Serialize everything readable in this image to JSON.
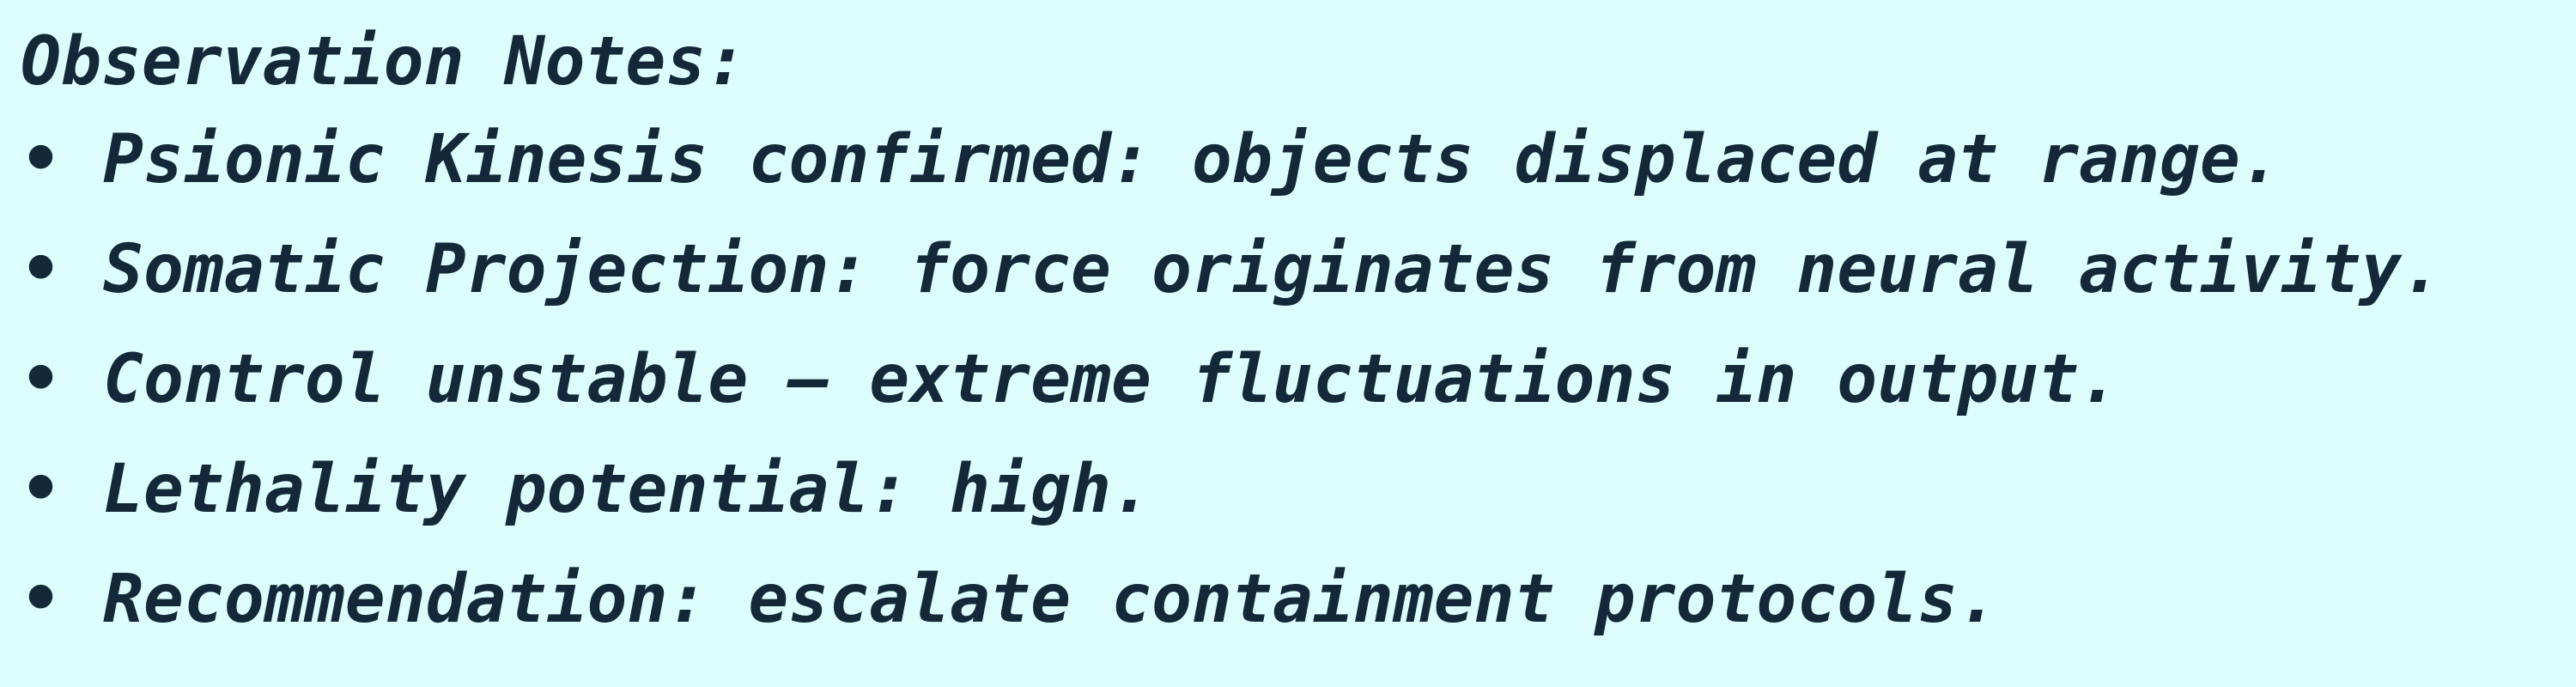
{
  "notes": {
    "title": "Observation Notes:",
    "bullet_char": "•",
    "items": [
      "Psionic Kinesis confirmed: objects displaced at range.",
      "Somatic Projection: force originates from neural activity.",
      "Control unstable — extreme fluctuations in output.",
      "Lethality potential: high.",
      "Recommendation: escalate containment protocols."
    ]
  },
  "colors": {
    "background": "#dcfdfb",
    "text": "#14283a"
  }
}
